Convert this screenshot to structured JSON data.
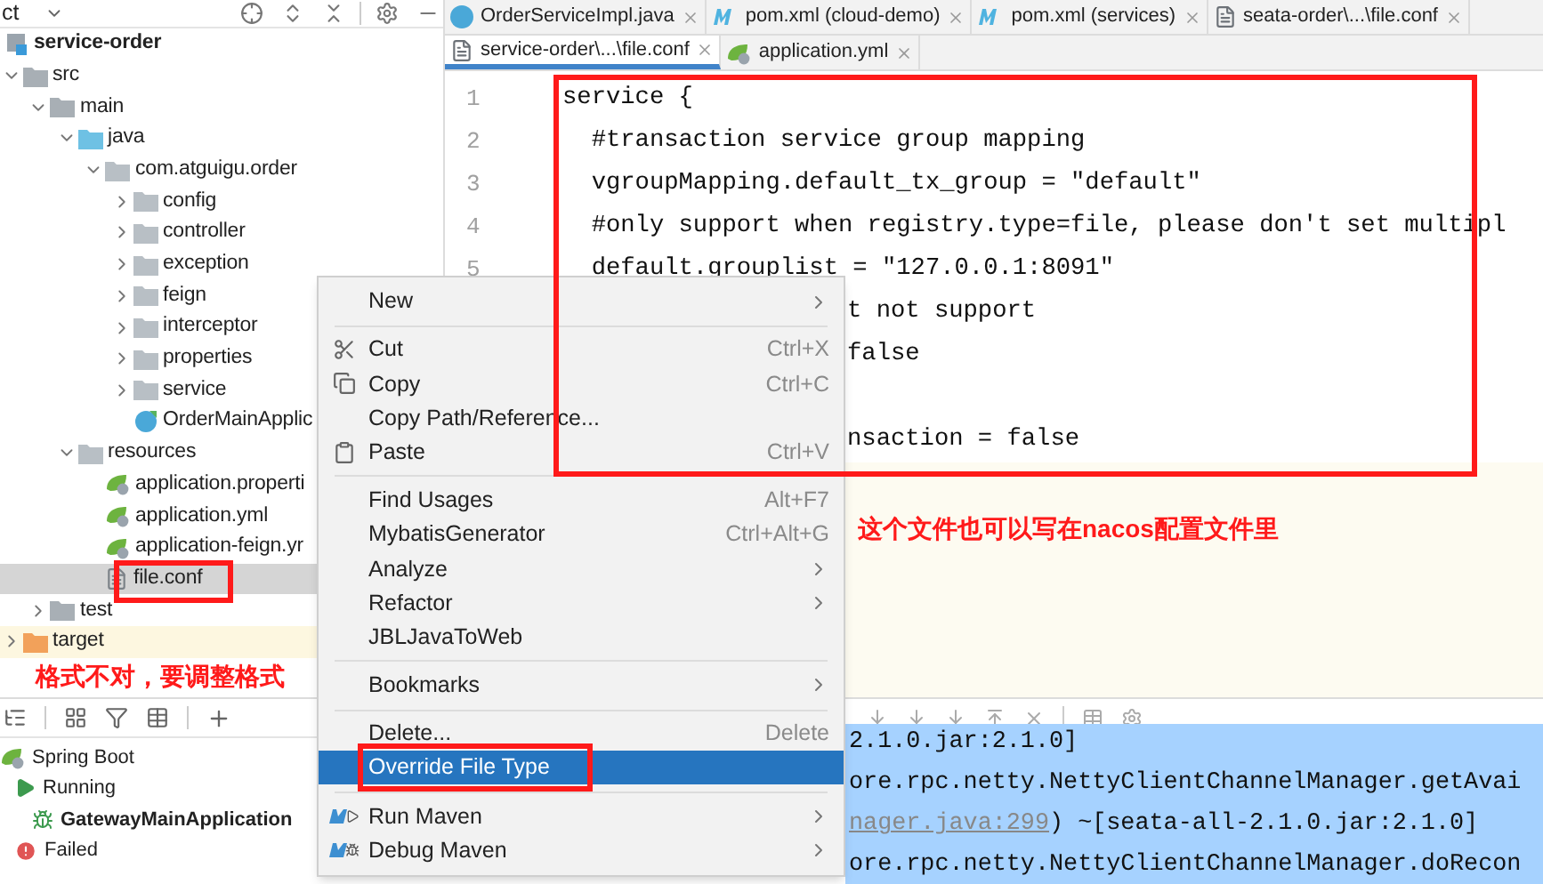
{
  "project_panel": {
    "header_label": "ct",
    "tree": [
      {
        "label": "service-order",
        "kind": "module",
        "selected": false,
        "children": [
          {
            "label": "src",
            "kind": "folder",
            "expanded": true,
            "selected": false,
            "children": [
              {
                "label": "main",
                "kind": "folder",
                "expanded": true,
                "selected": false,
                "children": [
                  {
                    "label": "java",
                    "kind": "source-folder",
                    "expanded": true,
                    "selected": false,
                    "children": [
                      {
                        "label": "com.atguigu.order",
                        "kind": "package",
                        "expanded": true,
                        "selected": false,
                        "children": [
                          {
                            "label": "config",
                            "kind": "package",
                            "expanded": false,
                            "selected": false
                          },
                          {
                            "label": "controller",
                            "kind": "package",
                            "expanded": false,
                            "selected": false
                          },
                          {
                            "label": "exception",
                            "kind": "package",
                            "expanded": false,
                            "selected": false
                          },
                          {
                            "label": "feign",
                            "kind": "package",
                            "expanded": false,
                            "selected": false
                          },
                          {
                            "label": "interceptor",
                            "kind": "package",
                            "expanded": false,
                            "selected": false
                          },
                          {
                            "label": "properties",
                            "kind": "package",
                            "expanded": false,
                            "selected": false
                          },
                          {
                            "label": "service",
                            "kind": "package",
                            "expanded": false,
                            "selected": false
                          },
                          {
                            "label": "OrderMainApplic",
                            "kind": "spring-class",
                            "selected": false
                          }
                        ]
                      }
                    ]
                  },
                  {
                    "label": "resources",
                    "kind": "resource-folder",
                    "expanded": true,
                    "selected": false,
                    "children": [
                      {
                        "label": "application.properti",
                        "kind": "spring-config",
                        "selected": false
                      },
                      {
                        "label": "application.yml",
                        "kind": "spring-config",
                        "selected": false
                      },
                      {
                        "label": "application-feign.yr",
                        "kind": "spring-config",
                        "selected": false
                      },
                      {
                        "label": "file.conf",
                        "kind": "text-file",
                        "selected": true
                      }
                    ]
                  }
                ]
              },
              {
                "label": "test",
                "kind": "folder",
                "expanded": false,
                "selected": false
              }
            ]
          },
          {
            "label": "target",
            "kind": "excluded-folder",
            "expanded": false,
            "selected": false
          }
        ]
      }
    ]
  },
  "editor_tabs": [
    [
      {
        "label": "OrderServiceImpl.java",
        "kind": "class",
        "selected": false
      },
      {
        "label": "pom.xml (cloud-demo)",
        "kind": "maven",
        "selected": false
      },
      {
        "label": "pom.xml (services)",
        "kind": "maven",
        "selected": false
      },
      {
        "label": "seata-order\\...\\file.conf",
        "kind": "text",
        "selected": false
      }
    ],
    [
      {
        "label": "service-order\\...\\file.conf",
        "kind": "text",
        "selected": true
      },
      {
        "label": "application.yml",
        "kind": "spring",
        "selected": false
      }
    ]
  ],
  "editor": {
    "lines": [
      {
        "number": "1",
        "text": "service {",
        "kind": "full"
      },
      {
        "number": "2",
        "text": "  #transaction service group mapping",
        "kind": "full"
      },
      {
        "number": "3",
        "text": "  vgroupMapping.default_tx_group = \"default\"",
        "kind": "full"
      },
      {
        "number": "4",
        "text": "  #only support when registry.type=file, please don't set multipl",
        "kind": "full"
      },
      {
        "number": "5",
        "text": "  default.grouplist = \"127.0.0.1:8091\"",
        "kind": "full"
      },
      {
        "text": "t not support",
        "kind": "partial"
      },
      {
        "text": "false",
        "kind": "partial"
      },
      {
        "kind": "partial"
      },
      {
        "text": "nsaction = false",
        "kind": "partial"
      }
    ]
  },
  "context_menu": [
    {
      "label": "New",
      "kind": "plain",
      "submenu": true,
      "selected": false
    },
    {
      "kind": "separator"
    },
    {
      "label": "Cut",
      "shortcut": "Ctrl+X",
      "kind": "cut",
      "submenu": false,
      "selected": false
    },
    {
      "label": "Copy",
      "shortcut": "Ctrl+C",
      "kind": "copy",
      "submenu": false,
      "selected": false
    },
    {
      "label": "Copy Path/Reference...",
      "kind": "plain",
      "submenu": false,
      "selected": false
    },
    {
      "label": "Paste",
      "shortcut": "Ctrl+V",
      "kind": "paste",
      "submenu": false,
      "selected": false
    },
    {
      "kind": "separator"
    },
    {
      "label": "Find Usages",
      "shortcut": "Alt+F7",
      "kind": "plain",
      "submenu": false,
      "selected": false
    },
    {
      "label": "MybatisGenerator",
      "shortcut": "Ctrl+Alt+G",
      "kind": "plain",
      "submenu": false,
      "selected": false
    },
    {
      "label": "Analyze",
      "kind": "plain",
      "submenu": true,
      "selected": false
    },
    {
      "label": "Refactor",
      "kind": "plain",
      "submenu": true,
      "selected": false
    },
    {
      "label": "JBLJavaToWeb",
      "kind": "plain",
      "submenu": false,
      "selected": false
    },
    {
      "kind": "separator"
    },
    {
      "label": "Bookmarks",
      "kind": "plain",
      "submenu": true,
      "selected": false
    },
    {
      "kind": "separator"
    },
    {
      "label": "Delete...",
      "shortcut": "Delete",
      "kind": "plain",
      "submenu": false,
      "selected": false
    },
    {
      "label": "Override File Type",
      "kind": "plain",
      "submenu": false,
      "selected": true
    },
    {
      "kind": "separator"
    },
    {
      "label": "Run Maven",
      "kind": "maven-run",
      "submenu": true,
      "selected": false
    },
    {
      "label": "Debug Maven",
      "kind": "maven-debug",
      "submenu": true,
      "selected": false
    }
  ],
  "run_panel": {
    "tree": [
      {
        "label": "Spring Boot",
        "kind": "group",
        "children": [
          {
            "label": "Running",
            "kind": "running",
            "children": [
              {
                "label": "GatewayMainApplication",
                "kind": "app"
              }
            ]
          },
          {
            "label": "Failed",
            "kind": "failed"
          }
        ]
      }
    ]
  },
  "console": {
    "lines": [
      {
        "text": "2.1.0.jar:2.1.0]",
        "selected": true
      },
      {
        "text": "ore.rpc.netty.NettyClientChannelManager.getAvai",
        "selected": true
      },
      {
        "link": "nager.java:299",
        "text": ") ~[seata-all-2.1.0.jar:2.1.0]",
        "selected": true
      },
      {
        "text": "ore.rpc.netty.NettyClientChannelManager.doRecon",
        "selected": true
      }
    ]
  },
  "annotations": [
    {
      "text": "这个文件也可以写在nacos配置文件里"
    },
    {
      "text": "格式不对，要调整格式"
    }
  ]
}
